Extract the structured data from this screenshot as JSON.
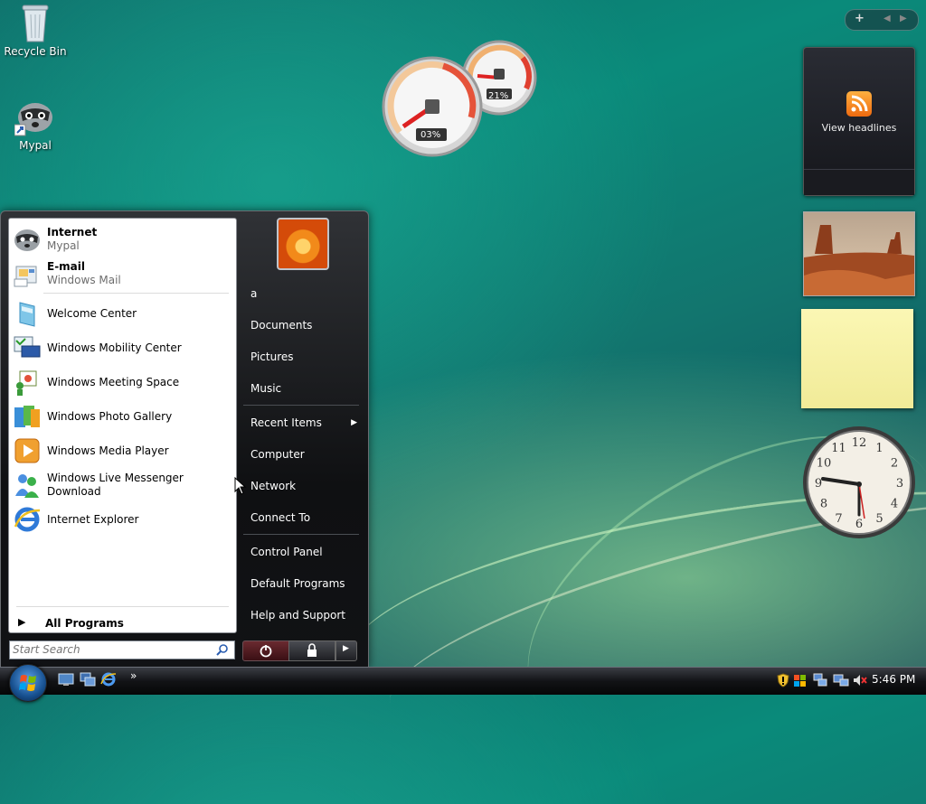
{
  "desktop": {
    "icons": [
      {
        "label": "Recycle Bin",
        "icon": "recycle-bin-icon"
      },
      {
        "label": "Mypal",
        "icon": "raccoon-shortcut-icon"
      }
    ]
  },
  "gadgets": {
    "meter": {
      "cpu_label": "03%",
      "memory_label": "21%"
    },
    "feed": {
      "label": "View headlines",
      "icon": "rss-icon"
    },
    "clock": {
      "numerals": [
        "12",
        "1",
        "2",
        "3",
        "4",
        "5",
        "6",
        "7",
        "8",
        "9",
        "10",
        "11"
      ],
      "time_shown": "5:46"
    }
  },
  "start_menu": {
    "pinned": [
      {
        "title": "Internet",
        "subtitle": "Mypal",
        "icon": "raccoon-icon"
      },
      {
        "title": "E-mail",
        "subtitle": "Windows Mail",
        "icon": "mail-icon"
      }
    ],
    "recent": [
      {
        "label": "Welcome Center",
        "icon": "welcome-center-icon"
      },
      {
        "label": "Windows Mobility Center",
        "icon": "mobility-center-icon"
      },
      {
        "label": "Windows Meeting Space",
        "icon": "meeting-space-icon"
      },
      {
        "label": "Windows Photo Gallery",
        "icon": "photo-gallery-icon"
      },
      {
        "label": "Windows Media Player",
        "icon": "media-player-icon"
      },
      {
        "label": "Windows Live Messenger Download",
        "icon": "messenger-icon"
      },
      {
        "label": "Internet Explorer",
        "icon": "internet-explorer-icon"
      }
    ],
    "all_programs": "All Programs",
    "search_placeholder": "Start Search",
    "right_links": [
      {
        "label": "a"
      },
      {
        "label": "Documents"
      },
      {
        "label": "Pictures"
      },
      {
        "label": "Music"
      },
      {
        "label": "Recent Items",
        "has_submenu": true
      },
      {
        "label": "Computer"
      },
      {
        "label": "Network"
      },
      {
        "label": "Connect To"
      },
      {
        "label": "Control Panel"
      },
      {
        "label": "Default Programs"
      },
      {
        "label": "Help and Support"
      }
    ]
  },
  "taskbar": {
    "quick_launch": [
      "show-desktop-icon",
      "switch-windows-icon",
      "internet-explorer-icon"
    ],
    "overflow": "»",
    "tray_icons": [
      "security-shield-icon",
      "network-icon",
      "volume-muted-icon"
    ],
    "clock": "5:46 PM"
  }
}
